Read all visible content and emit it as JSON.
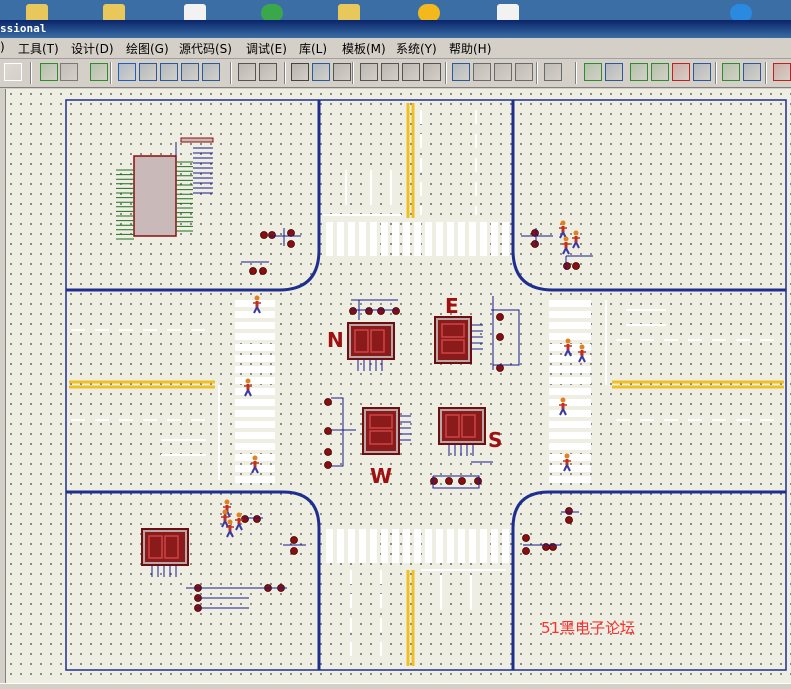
{
  "window": {
    "title": "ssional"
  },
  "menu": [
    {
      "label": ")"
    },
    {
      "label": "工具(T)"
    },
    {
      "label": "设计(D)"
    },
    {
      "label": "绘图(G)"
    },
    {
      "label": "源代码(S)"
    },
    {
      "label": "调试(E)"
    },
    {
      "label": "库(L)"
    },
    {
      "label": "模板(M)"
    },
    {
      "label": "系统(Y)"
    },
    {
      "label": "帮助(H)"
    }
  ],
  "toolbar": {
    "buttons": [
      {
        "icon": "new-sheet-icon"
      },
      {
        "icon": "refresh-icon"
      },
      {
        "icon": "grid-icon"
      },
      {
        "icon": "origin-icon"
      },
      {
        "icon": "pan-icon"
      },
      {
        "icon": "zoom-in-icon"
      },
      {
        "icon": "zoom-out-icon"
      },
      {
        "icon": "zoom-all-icon"
      },
      {
        "icon": "zoom-area-icon"
      },
      {
        "icon": "undo-icon"
      },
      {
        "icon": "redo-icon"
      },
      {
        "icon": "cut-icon"
      },
      {
        "icon": "copy-icon"
      },
      {
        "icon": "paste-icon"
      },
      {
        "icon": "block-copy-icon"
      },
      {
        "icon": "block-move-icon"
      },
      {
        "icon": "block-rotate-icon"
      },
      {
        "icon": "block-delete-icon"
      },
      {
        "icon": "pick-device-icon"
      },
      {
        "icon": "make-device-icon"
      },
      {
        "icon": "packaging-tool-icon"
      },
      {
        "icon": "decompose-icon"
      },
      {
        "icon": "wire-autorouter-icon"
      },
      {
        "icon": "search-tag-icon"
      },
      {
        "icon": "property-assign-icon"
      },
      {
        "icon": "new-sheet-2-icon"
      },
      {
        "icon": "add-sheet-icon"
      },
      {
        "icon": "remove-sheet-icon"
      },
      {
        "icon": "goto-sheet-icon"
      },
      {
        "icon": "bill-of-materials-icon"
      },
      {
        "icon": "electrical-check-icon"
      },
      {
        "icon": "ares-netlist-icon"
      }
    ]
  },
  "schematic": {
    "direction_labels": {
      "north": "N",
      "east": "E",
      "south": "S",
      "west": "W"
    },
    "watermark": "51黑电子论坛",
    "colors": {
      "road_edge": "#1f2f8f",
      "center_line": "#f0c020",
      "label_red": "#a01010",
      "component_red": "#8b0e0e",
      "display_bg": "#8b1a1a",
      "wire_blue": "#1a1a8f",
      "canvas_bg": "#efeee2"
    }
  }
}
